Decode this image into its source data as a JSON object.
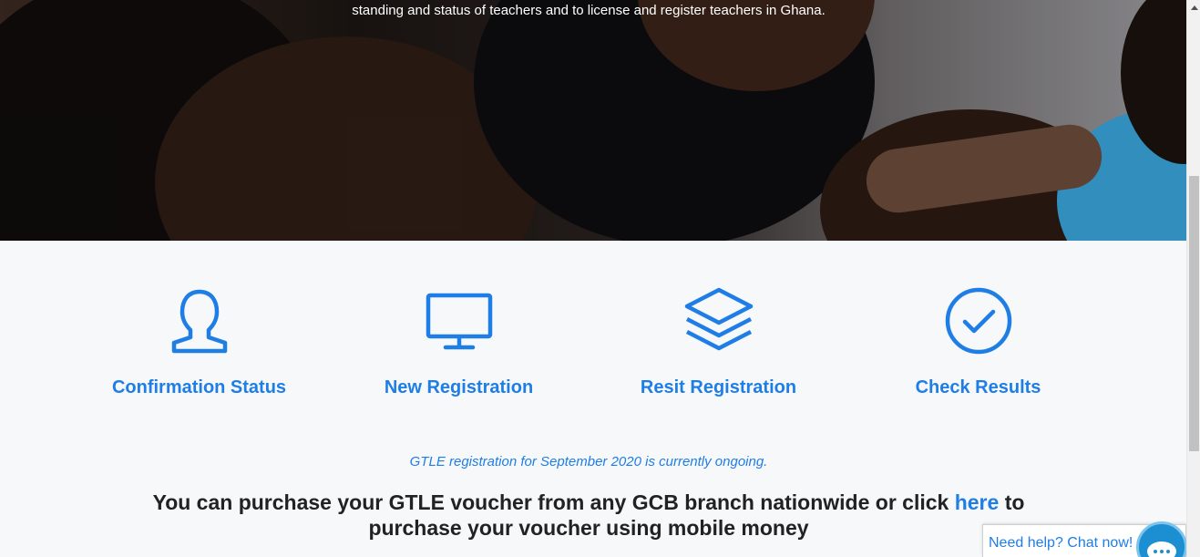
{
  "hero": {
    "text": "standing and status of teachers and to license and register teachers in Ghana."
  },
  "features": [
    {
      "label": "Confirmation Status",
      "icon": "user-icon"
    },
    {
      "label": "New Registration",
      "icon": "monitor-icon"
    },
    {
      "label": "Resit Registration",
      "icon": "layers-icon"
    },
    {
      "label": "Check Results",
      "icon": "check-circle-icon"
    }
  ],
  "notice": {
    "text": "GTLE registration for September 2020 is currently ongoing."
  },
  "purchase": {
    "before": "You can purchase your GTLE voucher from any GCB branch nationwide or click ",
    "link": "here",
    "after": " to purchase your voucher using mobile money"
  },
  "chat": {
    "label": "Need help? Chat now!",
    "icon": "chat-bubble-icon"
  },
  "colors": {
    "accent": "#1f7ee6",
    "background": "#f6f8fa",
    "text": "#222222"
  }
}
